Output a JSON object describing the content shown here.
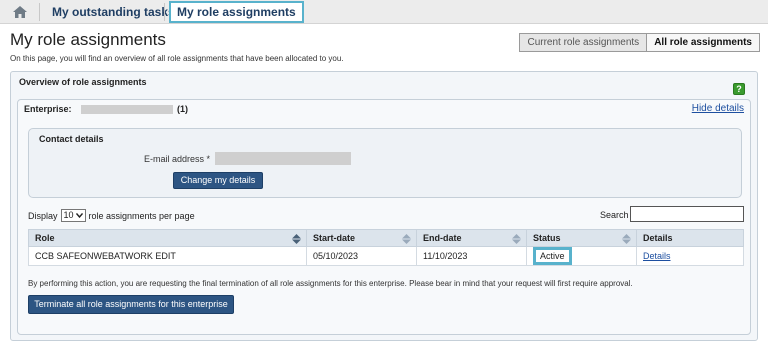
{
  "nav": {
    "home_icon": "home-icon",
    "tabs": [
      {
        "label": "My outstanding tasks"
      },
      {
        "label": "My role assignments"
      }
    ]
  },
  "page": {
    "title": "My role assignments",
    "intro": "On this page, you will find an overview of all role assignments that have been allocated to you."
  },
  "view_toggle": {
    "current_label": "Current role assignments",
    "all_label": "All role assignments"
  },
  "overview": {
    "title": "Overview of role assignments",
    "help_label": "?"
  },
  "enterprise": {
    "label": "Enterprise:",
    "count": "(1)",
    "hide_details": "Hide details"
  },
  "contact": {
    "title": "Contact details",
    "email_label": "E-mail address *",
    "change_button": "Change my details"
  },
  "listing": {
    "display_prefix": "Display",
    "page_size": "10",
    "display_suffix": "role assignments per page",
    "search_label": "Search"
  },
  "table": {
    "headers": [
      "Role",
      "Start-date",
      "End-date",
      "Status",
      "Details"
    ],
    "rows": [
      {
        "role": "CCB SAFEONWEBATWORK EDIT",
        "start": "05/10/2023",
        "end": "11/10/2023",
        "status": "Active",
        "details": "Details"
      }
    ]
  },
  "footer": {
    "warning": "By performing this action, you are requesting the final termination of all role assignments for this enterprise. Please bear in mind that your request will first require approval.",
    "terminate_button": "Terminate all role assignments for this enterprise"
  },
  "colors": {
    "accent_highlight": "#58b2cc",
    "button_blue": "#2d5583",
    "link_blue": "#1d4fa0"
  }
}
